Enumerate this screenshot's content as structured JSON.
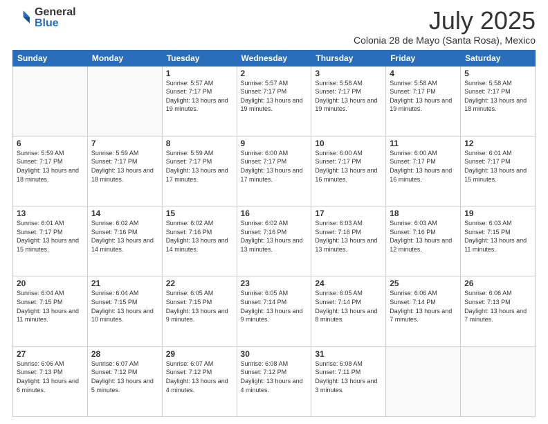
{
  "logo": {
    "general": "General",
    "blue": "Blue"
  },
  "title": {
    "month_year": "July 2025",
    "location": "Colonia 28 de Mayo (Santa Rosa), Mexico"
  },
  "days_of_week": [
    "Sunday",
    "Monday",
    "Tuesday",
    "Wednesday",
    "Thursday",
    "Friday",
    "Saturday"
  ],
  "weeks": [
    [
      {
        "day": "",
        "info": ""
      },
      {
        "day": "",
        "info": ""
      },
      {
        "day": "1",
        "info": "Sunrise: 5:57 AM\nSunset: 7:17 PM\nDaylight: 13 hours and 19 minutes."
      },
      {
        "day": "2",
        "info": "Sunrise: 5:57 AM\nSunset: 7:17 PM\nDaylight: 13 hours and 19 minutes."
      },
      {
        "day": "3",
        "info": "Sunrise: 5:58 AM\nSunset: 7:17 PM\nDaylight: 13 hours and 19 minutes."
      },
      {
        "day": "4",
        "info": "Sunrise: 5:58 AM\nSunset: 7:17 PM\nDaylight: 13 hours and 19 minutes."
      },
      {
        "day": "5",
        "info": "Sunrise: 5:58 AM\nSunset: 7:17 PM\nDaylight: 13 hours and 18 minutes."
      }
    ],
    [
      {
        "day": "6",
        "info": "Sunrise: 5:59 AM\nSunset: 7:17 PM\nDaylight: 13 hours and 18 minutes."
      },
      {
        "day": "7",
        "info": "Sunrise: 5:59 AM\nSunset: 7:17 PM\nDaylight: 13 hours and 18 minutes."
      },
      {
        "day": "8",
        "info": "Sunrise: 5:59 AM\nSunset: 7:17 PM\nDaylight: 13 hours and 17 minutes."
      },
      {
        "day": "9",
        "info": "Sunrise: 6:00 AM\nSunset: 7:17 PM\nDaylight: 13 hours and 17 minutes."
      },
      {
        "day": "10",
        "info": "Sunrise: 6:00 AM\nSunset: 7:17 PM\nDaylight: 13 hours and 16 minutes."
      },
      {
        "day": "11",
        "info": "Sunrise: 6:00 AM\nSunset: 7:17 PM\nDaylight: 13 hours and 16 minutes."
      },
      {
        "day": "12",
        "info": "Sunrise: 6:01 AM\nSunset: 7:17 PM\nDaylight: 13 hours and 15 minutes."
      }
    ],
    [
      {
        "day": "13",
        "info": "Sunrise: 6:01 AM\nSunset: 7:17 PM\nDaylight: 13 hours and 15 minutes."
      },
      {
        "day": "14",
        "info": "Sunrise: 6:02 AM\nSunset: 7:16 PM\nDaylight: 13 hours and 14 minutes."
      },
      {
        "day": "15",
        "info": "Sunrise: 6:02 AM\nSunset: 7:16 PM\nDaylight: 13 hours and 14 minutes."
      },
      {
        "day": "16",
        "info": "Sunrise: 6:02 AM\nSunset: 7:16 PM\nDaylight: 13 hours and 13 minutes."
      },
      {
        "day": "17",
        "info": "Sunrise: 6:03 AM\nSunset: 7:16 PM\nDaylight: 13 hours and 13 minutes."
      },
      {
        "day": "18",
        "info": "Sunrise: 6:03 AM\nSunset: 7:16 PM\nDaylight: 13 hours and 12 minutes."
      },
      {
        "day": "19",
        "info": "Sunrise: 6:03 AM\nSunset: 7:15 PM\nDaylight: 13 hours and 11 minutes."
      }
    ],
    [
      {
        "day": "20",
        "info": "Sunrise: 6:04 AM\nSunset: 7:15 PM\nDaylight: 13 hours and 11 minutes."
      },
      {
        "day": "21",
        "info": "Sunrise: 6:04 AM\nSunset: 7:15 PM\nDaylight: 13 hours and 10 minutes."
      },
      {
        "day": "22",
        "info": "Sunrise: 6:05 AM\nSunset: 7:15 PM\nDaylight: 13 hours and 9 minutes."
      },
      {
        "day": "23",
        "info": "Sunrise: 6:05 AM\nSunset: 7:14 PM\nDaylight: 13 hours and 9 minutes."
      },
      {
        "day": "24",
        "info": "Sunrise: 6:05 AM\nSunset: 7:14 PM\nDaylight: 13 hours and 8 minutes."
      },
      {
        "day": "25",
        "info": "Sunrise: 6:06 AM\nSunset: 7:14 PM\nDaylight: 13 hours and 7 minutes."
      },
      {
        "day": "26",
        "info": "Sunrise: 6:06 AM\nSunset: 7:13 PM\nDaylight: 13 hours and 7 minutes."
      }
    ],
    [
      {
        "day": "27",
        "info": "Sunrise: 6:06 AM\nSunset: 7:13 PM\nDaylight: 13 hours and 6 minutes."
      },
      {
        "day": "28",
        "info": "Sunrise: 6:07 AM\nSunset: 7:12 PM\nDaylight: 13 hours and 5 minutes."
      },
      {
        "day": "29",
        "info": "Sunrise: 6:07 AM\nSunset: 7:12 PM\nDaylight: 13 hours and 4 minutes."
      },
      {
        "day": "30",
        "info": "Sunrise: 6:08 AM\nSunset: 7:12 PM\nDaylight: 13 hours and 4 minutes."
      },
      {
        "day": "31",
        "info": "Sunrise: 6:08 AM\nSunset: 7:11 PM\nDaylight: 13 hours and 3 minutes."
      },
      {
        "day": "",
        "info": ""
      },
      {
        "day": "",
        "info": ""
      }
    ]
  ]
}
